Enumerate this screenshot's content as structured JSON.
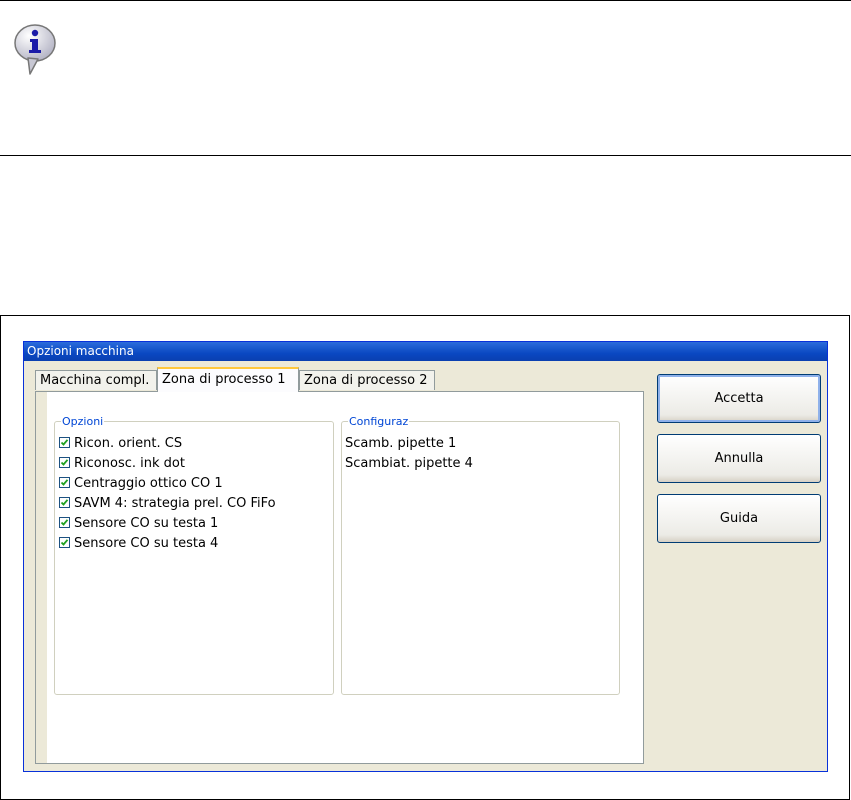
{
  "dialog": {
    "title": "Opzioni macchina",
    "tabs": [
      {
        "label": "Macchina compl."
      },
      {
        "label": "Zona di processo 1"
      },
      {
        "label": "Zona di processo 2"
      }
    ],
    "active_tab": "Zona di processo 1",
    "options_group": {
      "legend": "Opzioni",
      "items": [
        {
          "label": "Ricon. orient. CS",
          "checked": true
        },
        {
          "label": "Riconosc. ink dot",
          "checked": true
        },
        {
          "label": "Centraggio ottico CO 1",
          "checked": true
        },
        {
          "label": "SAVM 4: strategia prel. CO FiFo",
          "checked": true
        },
        {
          "label": "Sensore CO su testa 1",
          "checked": true
        },
        {
          "label": "Sensore CO su testa 4",
          "checked": true
        }
      ]
    },
    "config_group": {
      "legend": "Configuraz",
      "items": [
        {
          "label": "Scamb. pipette 1"
        },
        {
          "label": "Scambiat. pipette 4"
        }
      ]
    },
    "buttons": {
      "accept": "Accetta",
      "cancel": "Annulla",
      "help": "Guida"
    }
  },
  "colors": {
    "dialog_bg": "#ece9d8",
    "titlebar": "#0a48c2",
    "legend": "#0046d5",
    "checkmark": "#21a121",
    "active_tab_highlight": "#ffc83c"
  },
  "icons": [
    "info-icon",
    "checkmark-icon"
  ]
}
